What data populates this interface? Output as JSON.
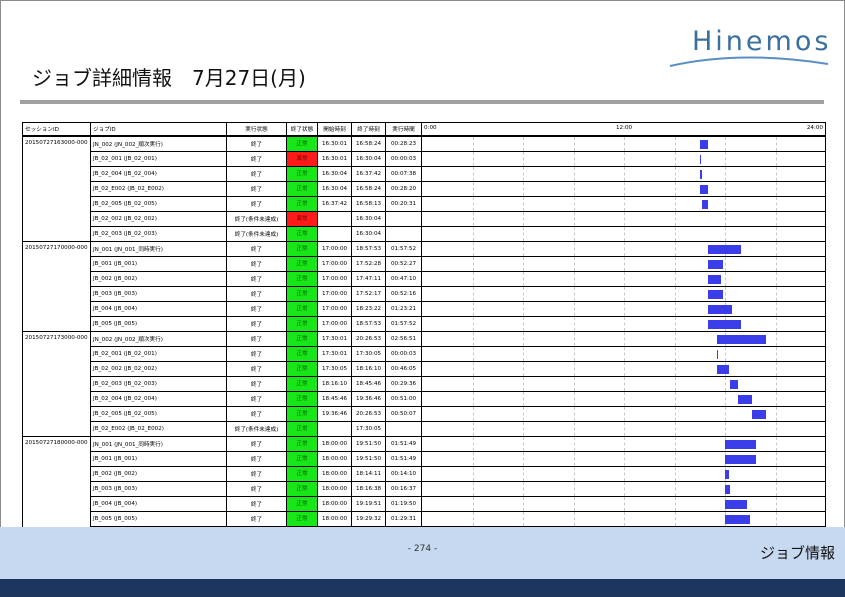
{
  "logo": {
    "text": "Hinemos"
  },
  "title": "ジョブ詳細情報　7月27日(月)",
  "table": {
    "headers": {
      "session": "セッションID",
      "job": "ジョブID",
      "state": "実行状態",
      "end_state": "終了状態",
      "start": "開始時刻",
      "end": "終了時刻",
      "duration": "実行時間"
    },
    "axis": {
      "left": "0:00",
      "mid": "12:00",
      "right": "24:00"
    },
    "axis_hours": [
      0,
      24
    ],
    "colors": {
      "ok": "#19e619",
      "err": "#ff1a1a",
      "bar": "#3a3de8"
    },
    "groups": [
      {
        "session": "20150727163000-000",
        "rows": [
          {
            "job": "JN_002 (JN_002_順次実行)",
            "state": "終了",
            "end_state": "正常",
            "status": "ok",
            "start": "16:30:01",
            "end": "16:58:24",
            "duration": "00:28:23"
          },
          {
            "job": "JB_02_001 (JB_02_001)",
            "state": "終了",
            "end_state": "異常",
            "status": "err",
            "start": "16:30:01",
            "end": "16:30:04",
            "duration": "00:00:03"
          },
          {
            "job": "JB_02_004 (JB_02_004)",
            "state": "終了",
            "end_state": "正常",
            "status": "ok",
            "start": "16:30:04",
            "end": "16:37:42",
            "duration": "00:07:38"
          },
          {
            "job": "JB_02_E002 (JB_02_E002)",
            "state": "終了",
            "end_state": "正常",
            "status": "ok",
            "start": "16:30:04",
            "end": "16:58:24",
            "duration": "00:28:20"
          },
          {
            "job": "JB_02_005 (JB_02_005)",
            "state": "終了",
            "end_state": "正常",
            "status": "ok",
            "start": "16:37:42",
            "end": "16:58:13",
            "duration": "00:20:31"
          },
          {
            "job": "JB_02_002 (JB_02_002)",
            "state": "終了(条件未達成)",
            "end_state": "異常",
            "status": "err",
            "start": "",
            "end": "16:30:04",
            "duration": ""
          },
          {
            "job": "JB_02_003 (JB_02_003)",
            "state": "終了(条件未達成)",
            "end_state": "正常",
            "status": "ok",
            "start": "",
            "end": "16:30:04",
            "duration": ""
          }
        ]
      },
      {
        "session": "20150727170000-000",
        "rows": [
          {
            "job": "JN_001 (JN_001_同時実行)",
            "state": "終了",
            "end_state": "正常",
            "status": "ok",
            "start": "17:00:00",
            "end": "18:57:53",
            "duration": "01:57:52"
          },
          {
            "job": "JB_001 (JB_001)",
            "state": "終了",
            "end_state": "正常",
            "status": "ok",
            "start": "17:00:00",
            "end": "17:52:28",
            "duration": "00:52:27"
          },
          {
            "job": "JB_002 (JB_002)",
            "state": "終了",
            "end_state": "正常",
            "status": "ok",
            "start": "17:00:00",
            "end": "17:47:11",
            "duration": "00:47:10"
          },
          {
            "job": "JB_003 (JB_003)",
            "state": "終了",
            "end_state": "正常",
            "status": "ok",
            "start": "17:00:00",
            "end": "17:52:17",
            "duration": "00:52:16"
          },
          {
            "job": "JB_004 (JB_004)",
            "state": "終了",
            "end_state": "正常",
            "status": "ok",
            "start": "17:00:00",
            "end": "18:23:22",
            "duration": "01:23:21"
          },
          {
            "job": "JB_005 (JB_005)",
            "state": "終了",
            "end_state": "正常",
            "status": "ok",
            "start": "17:00:00",
            "end": "18:57:53",
            "duration": "01:57:52"
          }
        ]
      },
      {
        "session": "20150727173000-000",
        "rows": [
          {
            "job": "JN_002 (JN_002_順次実行)",
            "state": "終了",
            "end_state": "正常",
            "status": "ok",
            "start": "17:30:01",
            "end": "20:26:53",
            "duration": "02:56:51"
          },
          {
            "job": "JB_02_001 (JB_02_001)",
            "state": "終了",
            "end_state": "正常",
            "status": "ok",
            "start": "17:30:01",
            "end": "17:30:05",
            "duration": "00:00:03"
          },
          {
            "job": "JB_02_002 (JB_02_002)",
            "state": "終了",
            "end_state": "正常",
            "status": "ok",
            "start": "17:30:05",
            "end": "18:16:10",
            "duration": "00:46:05"
          },
          {
            "job": "JB_02_003 (JB_02_003)",
            "state": "終了",
            "end_state": "正常",
            "status": "ok",
            "start": "18:16:10",
            "end": "18:45:46",
            "duration": "00:29:36"
          },
          {
            "job": "JB_02_004 (JB_02_004)",
            "state": "終了",
            "end_state": "正常",
            "status": "ok",
            "start": "18:45:46",
            "end": "19:36:46",
            "duration": "00:51:00"
          },
          {
            "job": "JB_02_005 (JB_02_005)",
            "state": "終了",
            "end_state": "正常",
            "status": "ok",
            "start": "19:36:46",
            "end": "20:26:53",
            "duration": "00:50:07"
          },
          {
            "job": "JB_02_E002 (JB_02_E002)",
            "state": "終了(条件未達成)",
            "end_state": "正常",
            "status": "ok",
            "start": "",
            "end": "17:30:05",
            "duration": ""
          }
        ]
      },
      {
        "session": "20150727180000-000",
        "rows": [
          {
            "job": "JN_001 (JN_001_同時実行)",
            "state": "終了",
            "end_state": "正常",
            "status": "ok",
            "start": "18:00:00",
            "end": "19:51:50",
            "duration": "01:51:49"
          },
          {
            "job": "JB_001 (JB_001)",
            "state": "終了",
            "end_state": "正常",
            "status": "ok",
            "start": "18:00:00",
            "end": "19:51:50",
            "duration": "01:51:49"
          },
          {
            "job": "JB_002 (JB_002)",
            "state": "終了",
            "end_state": "正常",
            "status": "ok",
            "start": "18:00:00",
            "end": "18:14:11",
            "duration": "00:14:10"
          },
          {
            "job": "JB_003 (JB_003)",
            "state": "終了",
            "end_state": "正常",
            "status": "ok",
            "start": "18:00:00",
            "end": "18:16:38",
            "duration": "00:16:37"
          },
          {
            "job": "JB_004 (JB_004)",
            "state": "終了",
            "end_state": "正常",
            "status": "ok",
            "start": "18:00:00",
            "end": "19:19:51",
            "duration": "01:19:50"
          },
          {
            "job": "JB_005 (JB_005)",
            "state": "終了",
            "end_state": "正常",
            "status": "ok",
            "start": "18:00:00",
            "end": "19:29:32",
            "duration": "01:29:31"
          }
        ]
      }
    ]
  },
  "footer": {
    "page": "- 274 -",
    "section": "ジョブ情報"
  }
}
